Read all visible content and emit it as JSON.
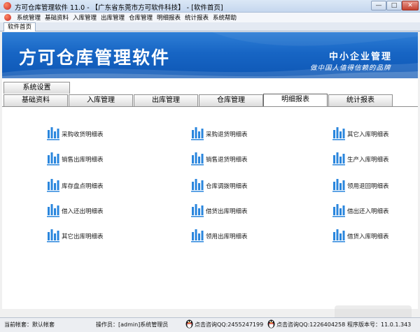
{
  "window": {
    "title": "方可仓库管理软件 11.0 - 【广东省东莞市方可软件科技】 - [软件首页]",
    "min_glyph": "—",
    "max_glyph": "□",
    "close_glyph": "✕"
  },
  "menu": [
    "系统管理",
    "基础资料",
    "入库管理",
    "出库管理",
    "仓库管理",
    "明细报表",
    "统计报表",
    "系统帮助"
  ],
  "doc_tab": "软件首页",
  "banner": {
    "title": "方可仓库管理软件",
    "slogan_main": "中小企业管理",
    "slogan_sub": "做中国人值得信赖的品牌",
    "gradient_top": "#2f7fd6",
    "gradient_bottom": "#0e57b5"
  },
  "tabs": {
    "row1": [
      "系统设置"
    ],
    "row2": [
      "基础资料",
      "入库管理",
      "出库管理",
      "仓库管理",
      "明细报表",
      "统计报表"
    ],
    "active": "明细报表"
  },
  "reports": [
    [
      "采购收货明细表",
      "采购退货明细表",
      "其它入库明细表"
    ],
    [
      "销售出库明细表",
      "销售退货明细表",
      "生产入库明细表"
    ],
    [
      "库存盘点明细表",
      "仓库调拨明细表",
      "领用退回明细表"
    ],
    [
      "借入还出明细表",
      "借货出库明细表",
      "借出还入明细表"
    ],
    [
      "其它出库明细表",
      "领用出库明细表",
      "借货入库明细表"
    ]
  ],
  "report_icon": "bar-chart-icon",
  "icon_color": "#2a86dd",
  "status": {
    "account": "当前帐套：默认帐套",
    "operator": "操作员：[admin]系统管理员",
    "qq1": "点击咨询QQ:2455247199",
    "qq2": "点击咨询QQ:1226404258",
    "version": "程序版本号：11.0.1.343"
  }
}
